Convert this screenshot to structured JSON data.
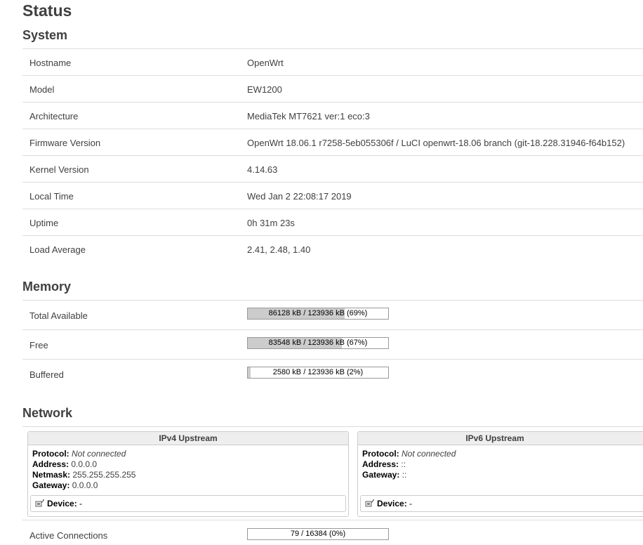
{
  "page": {
    "title": "Status"
  },
  "system": {
    "title": "System",
    "rows": [
      {
        "label": "Hostname",
        "value": "OpenWrt"
      },
      {
        "label": "Model",
        "value": "EW1200"
      },
      {
        "label": "Architecture",
        "value": "MediaTek MT7621 ver:1 eco:3"
      },
      {
        "label": "Firmware Version",
        "value": "OpenWrt 18.06.1 r7258-5eb055306f / LuCI openwrt-18.06 branch (git-18.228.31946-f64b152)"
      },
      {
        "label": "Kernel Version",
        "value": "4.14.63"
      },
      {
        "label": "Local Time",
        "value": "Wed Jan 2 22:08:17 2019"
      },
      {
        "label": "Uptime",
        "value": "0h 31m 23s"
      },
      {
        "label": "Load Average",
        "value": "2.41, 2.48, 1.40"
      }
    ]
  },
  "memory": {
    "title": "Memory",
    "rows": [
      {
        "label": "Total Available",
        "text": "86128 kB / 123936 kB (69%)",
        "percent": 69
      },
      {
        "label": "Free",
        "text": "83548 kB / 123936 kB (67%)",
        "percent": 67
      },
      {
        "label": "Buffered",
        "text": "2580 kB / 123936 kB (2%)",
        "percent": 2
      }
    ]
  },
  "network": {
    "title": "Network",
    "ipv4": {
      "title": "IPv4 Upstream",
      "protocol_label": "Protocol:",
      "protocol_value": "Not connected",
      "address_label": "Address:",
      "address_value": "0.0.0.0",
      "netmask_label": "Netmask:",
      "netmask_value": "255.255.255.255",
      "gateway_label": "Gateway:",
      "gateway_value": "0.0.0.0",
      "device_label": "Device:",
      "device_value": "-",
      "device_icon": "ethernet-port-icon"
    },
    "ipv6": {
      "title": "IPv6 Upstream",
      "protocol_label": "Protocol:",
      "protocol_value": "Not connected",
      "address_label": "Address:",
      "address_value": "::",
      "gateway_label": "Gateway:",
      "gateway_value": "::",
      "device_label": "Device:",
      "device_value": "-",
      "device_icon": "ethernet-port-icon"
    },
    "active_connections": {
      "label": "Active Connections",
      "text": "79 / 16384 (0%)",
      "percent": 0
    }
  }
}
